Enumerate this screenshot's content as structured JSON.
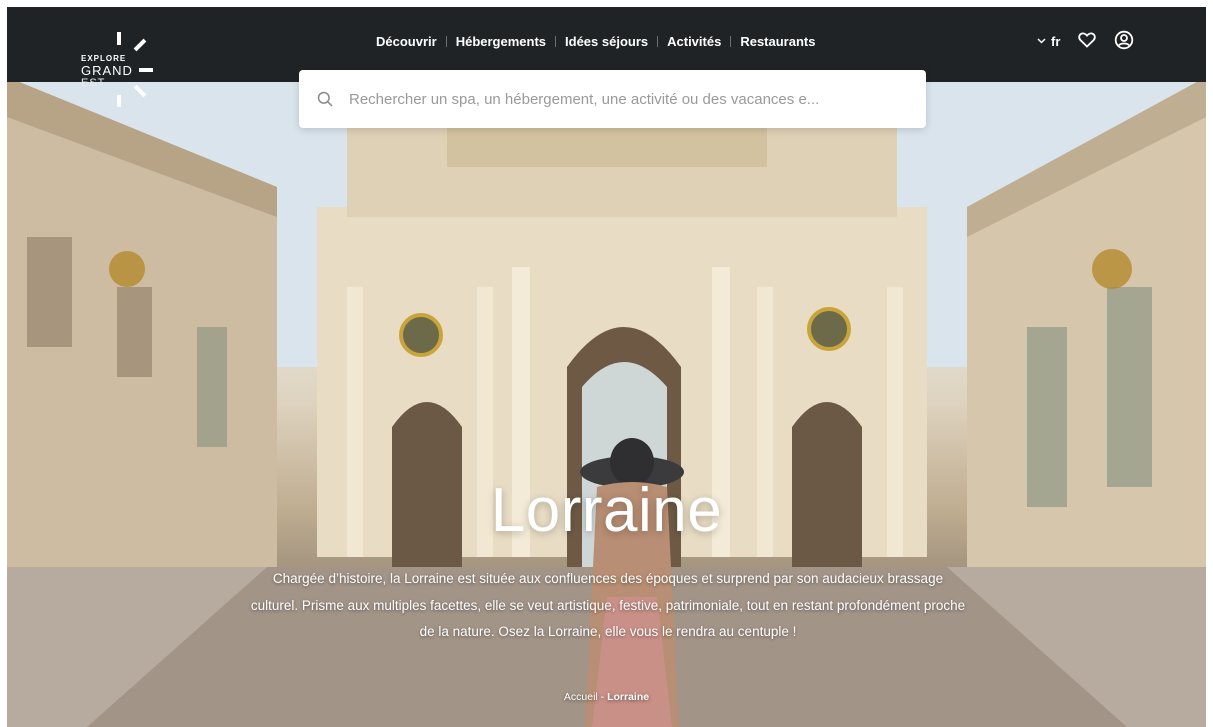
{
  "brand": {
    "line1": "EXPLORE",
    "line2": "GRAND",
    "line3": "EST"
  },
  "nav": {
    "items": [
      {
        "label": "Découvrir"
      },
      {
        "label": "Hébergements"
      },
      {
        "label": "Idées séjours"
      },
      {
        "label": "Activités"
      },
      {
        "label": "Restaurants"
      }
    ]
  },
  "tools": {
    "language": "fr",
    "icons": [
      "chevron-down-icon",
      "heart-icon",
      "user-icon"
    ]
  },
  "search": {
    "placeholder": "Rechercher un spa, un hébergement, une activité ou des vacances e..."
  },
  "hero": {
    "title": "Lorraine",
    "description": "Chargée d’histoire, la Lorraine est située aux confluences des époques et surprend par son audacieux brassage culturel. Prisme aux multiples facettes, elle se veut artistique, festive, patrimoniale, tout en restant profondément proche de la nature. Osez la Lorraine, elle vous le rendra au centuple !"
  },
  "breadcrumb": {
    "home": "Accueil",
    "separator": "-",
    "current": "Lorraine"
  },
  "colors": {
    "header_bg": "#202326",
    "text_on_dark": "#ffffff",
    "search_bg": "#ffffff",
    "placeholder": "#9a9a9a"
  }
}
